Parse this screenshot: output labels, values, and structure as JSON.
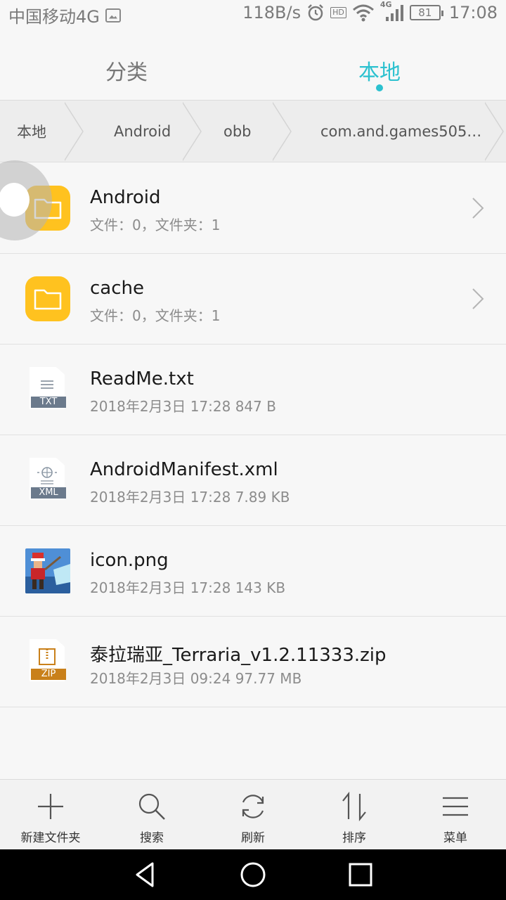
{
  "status_bar": {
    "carrier": "中国移动4G",
    "net_speed": "118B/s",
    "hd_label": "HD",
    "signal_label": "4G",
    "battery": "81",
    "time": "17:08"
  },
  "tabs": [
    {
      "label": "分类",
      "active": false
    },
    {
      "label": "本地",
      "active": true
    }
  ],
  "breadcrumb": [
    "本地",
    "Android",
    "obb",
    "com.and.games505…"
  ],
  "files": [
    {
      "name": "Android",
      "meta": "文件：0，文件夹：1",
      "type": "folder",
      "icon": "folder-icon"
    },
    {
      "name": "cache",
      "meta": "文件：0，文件夹：1",
      "type": "folder",
      "icon": "folder-icon"
    },
    {
      "name": "ReadMe.txt",
      "meta": "2018年2月3日 17:28 847 B",
      "type": "txt",
      "tag": "TXT",
      "icon": "txt-file-icon"
    },
    {
      "name": "AndroidManifest.xml",
      "meta": "2018年2月3日 17:28 7.89 KB",
      "type": "xml",
      "tag": "XML",
      "icon": "xml-file-icon"
    },
    {
      "name": "icon.png",
      "meta": "2018年2月3日 17:28 143 KB",
      "type": "png",
      "icon": "image-thumbnail"
    },
    {
      "name": "泰拉瑞亚_Terraria_v1.2.11333.zip",
      "meta": "2018年2月3日 09:24 97.77 MB",
      "type": "zip",
      "tag": "ZIP",
      "icon": "zip-file-icon"
    }
  ],
  "toolbar": [
    {
      "label": "新建文件夹",
      "icon": "plus-icon"
    },
    {
      "label": "搜索",
      "icon": "search-icon"
    },
    {
      "label": "刷新",
      "icon": "refresh-icon"
    },
    {
      "label": "排序",
      "icon": "sort-icon"
    },
    {
      "label": "菜单",
      "icon": "menu-icon"
    }
  ],
  "colors": {
    "accent": "#2cc1cf",
    "folder": "#ffc21f",
    "txt_tag": "#6b7a8c",
    "xml_tag": "#6b7a8c",
    "zip_tag": "#c9801a"
  }
}
